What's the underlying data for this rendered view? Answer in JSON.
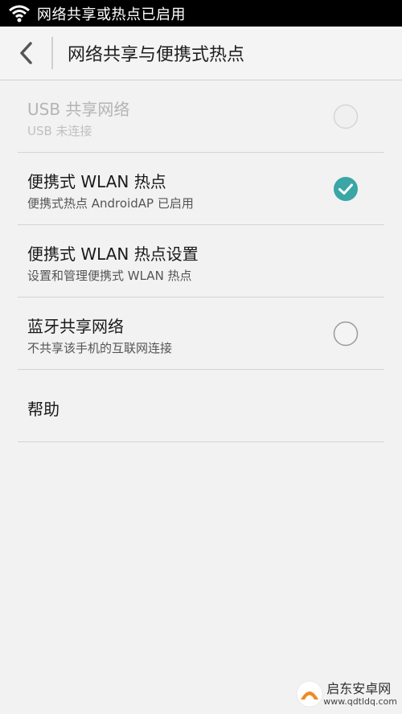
{
  "status_bar": {
    "text": "网络共享或热点已启用",
    "icon": "wifi-hotspot-icon"
  },
  "header": {
    "title": "网络共享与便携式热点",
    "back_icon": "back-arrow-icon"
  },
  "items": [
    {
      "title": "USB 共享网络",
      "subtitle": "USB 未连接",
      "checkbox": "unchecked",
      "enabled": false
    },
    {
      "title": "便携式 WLAN 热点",
      "subtitle": "便携式热点 AndroidAP 已启用",
      "checkbox": "checked",
      "enabled": true
    },
    {
      "title": "便携式 WLAN 热点设置",
      "subtitle": "设置和管理便携式 WLAN 热点",
      "checkbox": "none",
      "enabled": true
    },
    {
      "title": "蓝牙共享网络",
      "subtitle": "不共享该手机的互联网连接",
      "checkbox": "unchecked",
      "enabled": true
    },
    {
      "title": "帮助",
      "subtitle": "",
      "checkbox": "none",
      "enabled": true
    }
  ],
  "colors": {
    "accent": "#3aa6a6",
    "status_bar_bg": "#000000",
    "background": "#f2f2f2"
  },
  "watermark": {
    "name": "启东安卓网",
    "url": "www.qdtldq.com"
  }
}
